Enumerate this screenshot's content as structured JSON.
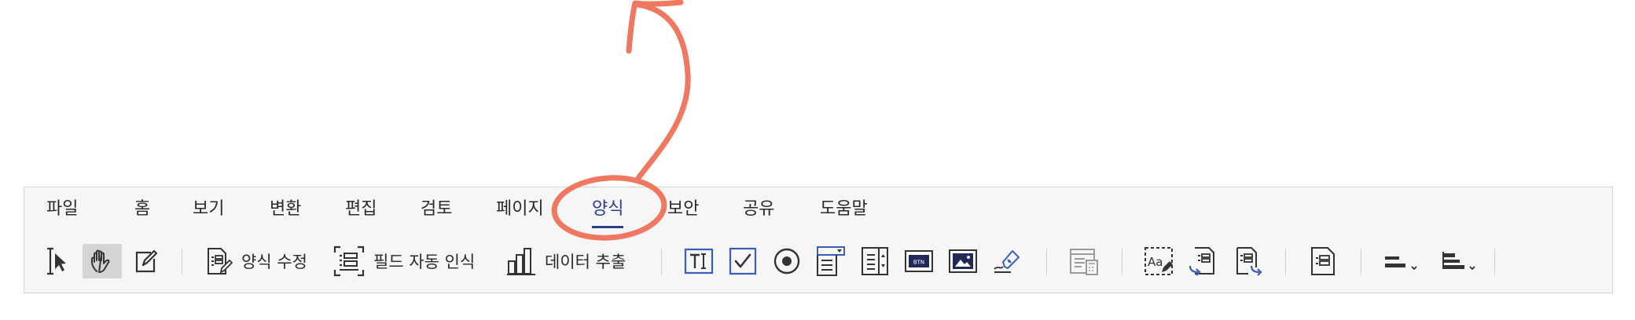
{
  "menu": {
    "tabs": [
      {
        "label": "파일"
      },
      {
        "label": "홈"
      },
      {
        "label": "보기"
      },
      {
        "label": "변환"
      },
      {
        "label": "편집"
      },
      {
        "label": "검토"
      },
      {
        "label": "페이지"
      },
      {
        "label": "양식",
        "active": true
      },
      {
        "label": "보안"
      },
      {
        "label": "공유"
      },
      {
        "label": "도움말"
      }
    ]
  },
  "toolbar": {
    "edit_form_label": "양식 수정",
    "auto_detect_label": "필드 자동 인식",
    "data_extract_label": "데이터 추출",
    "button_field_text": "BTN"
  },
  "colors": {
    "accent": "#2b3d8f",
    "annotation": "#f07860",
    "icon": "#333333",
    "icon_blue": "#3a5db8"
  }
}
